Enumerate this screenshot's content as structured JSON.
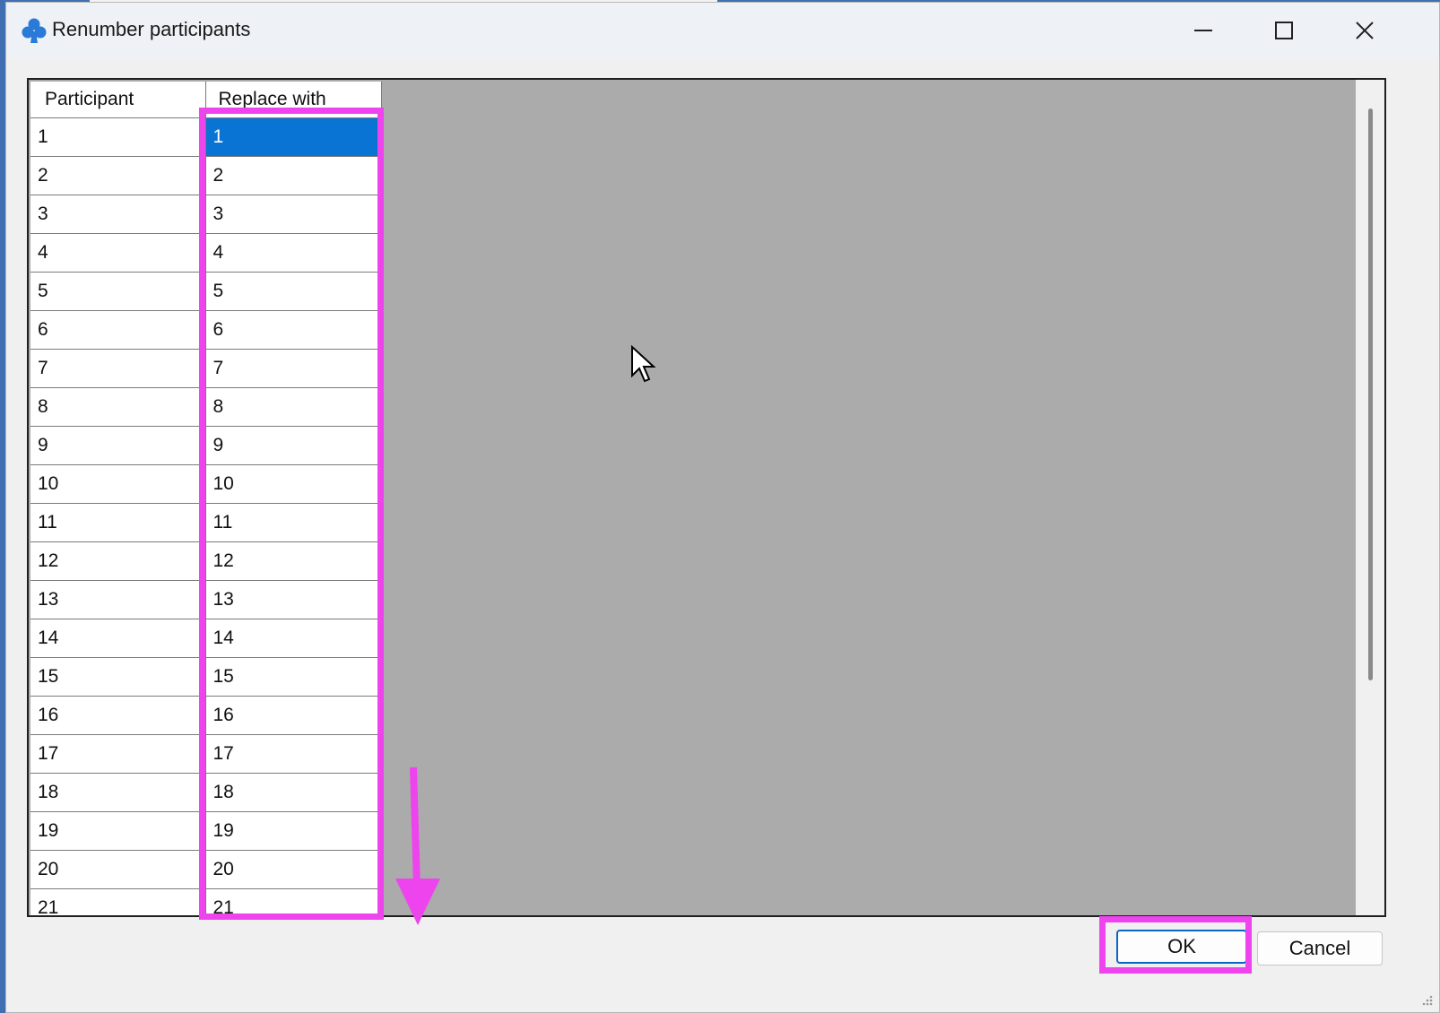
{
  "dialog": {
    "title": "Renumber participants"
  },
  "grid": {
    "columns": [
      "Participant",
      "Replace with"
    ],
    "selected_row": 0,
    "rows": [
      {
        "participant": "1",
        "replace": "1"
      },
      {
        "participant": "2",
        "replace": "2"
      },
      {
        "participant": "3",
        "replace": "3"
      },
      {
        "participant": "4",
        "replace": "4"
      },
      {
        "participant": "5",
        "replace": "5"
      },
      {
        "participant": "6",
        "replace": "6"
      },
      {
        "participant": "7",
        "replace": "7"
      },
      {
        "participant": "8",
        "replace": "8"
      },
      {
        "participant": "9",
        "replace": "9"
      },
      {
        "participant": "10",
        "replace": "10"
      },
      {
        "participant": "11",
        "replace": "11"
      },
      {
        "participant": "12",
        "replace": "12"
      },
      {
        "participant": "13",
        "replace": "13"
      },
      {
        "participant": "14",
        "replace": "14"
      },
      {
        "participant": "15",
        "replace": "15"
      },
      {
        "participant": "16",
        "replace": "16"
      },
      {
        "participant": "17",
        "replace": "17"
      },
      {
        "participant": "18",
        "replace": "18"
      },
      {
        "participant": "19",
        "replace": "19"
      },
      {
        "participant": "20",
        "replace": "20"
      },
      {
        "participant": "21",
        "replace": "21"
      }
    ]
  },
  "buttons": {
    "ok": "OK",
    "cancel": "Cancel"
  },
  "annotation": {
    "color": "#ee44ee"
  },
  "colors": {
    "selection": "#0a74d4",
    "ok_border": "#0a64c8",
    "grid_background": "#ababab"
  },
  "icons": {
    "app": "club-icon",
    "minimize": "minimize-icon",
    "maximize": "maximize-icon",
    "close": "close-icon",
    "cursor": "mouse-pointer-icon",
    "arrow": "down-arrow-annotation"
  }
}
